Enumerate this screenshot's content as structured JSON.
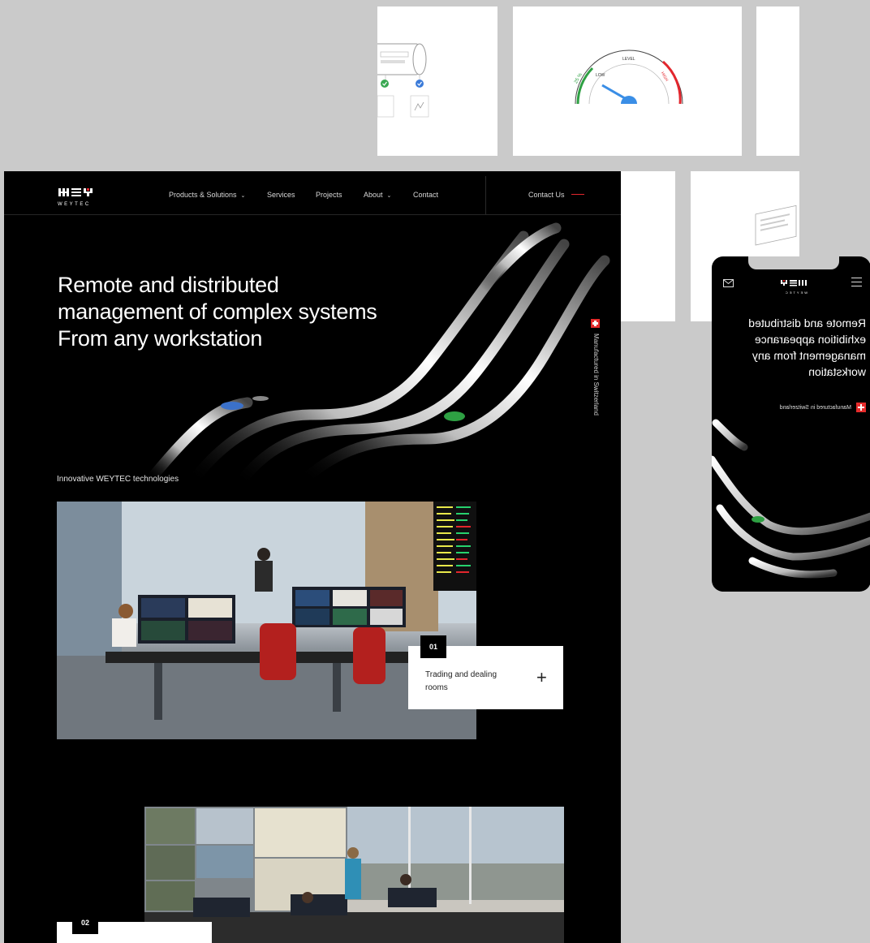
{
  "brand": {
    "logo_text": "WEYTEC"
  },
  "colors": {
    "accent_red": "#e2262d",
    "swiss_red": "#e52b2b",
    "blue_dot": "#3b71c9",
    "green_dot": "#2ea043",
    "gauge_blue": "#3a8ee6"
  },
  "nav": {
    "items": [
      "Products & Solutions",
      "Services",
      "Projects",
      "About",
      "Contact"
    ],
    "cta_label": "Contact Us"
  },
  "hero": {
    "title_line1": "Remote and distributed",
    "title_line2": "management of complex systems",
    "title_line3": "From any workstation",
    "manufactured": "Manufactured in Switzerland"
  },
  "section": {
    "label": "Innovative WEYTEC technologies",
    "items": [
      {
        "number": "01",
        "title": "Trading and dealing rooms",
        "plus": "+"
      },
      {
        "number": "02",
        "title": ""
      }
    ]
  },
  "mobile": {
    "logo_text": "WEYTEC",
    "title": "Remote and distributed exhibition appearance management from any workstation",
    "manufactured": "Manufactured in Switzerland",
    "icons": [
      "mail-icon",
      "menu-icon"
    ]
  },
  "gauge": {
    "value_label": "LEVEL",
    "low_label": "25 %",
    "high_label": "HIGH",
    "mid_label": "LOW"
  }
}
